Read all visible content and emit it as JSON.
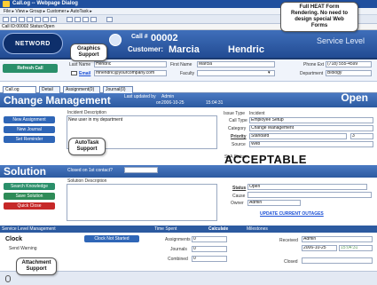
{
  "window": {
    "title": "Call.og -- Webpage Dialog"
  },
  "menu": {
    "text": "File ▸ View ▸ Group ▸ Customer ▸ AutoTask ▸"
  },
  "status_line": {
    "text": "Call ID:00002 Status:Open"
  },
  "header": {
    "logo": "NETWORD",
    "call_label": "Call #",
    "call_number": "00002",
    "customer_label": "Customer:",
    "customer_first": "Marcia",
    "customer_last": "Hendric",
    "service_level_label": "Service Level"
  },
  "refresh_button": "Refresh Call",
  "contact": {
    "last_name_label": "Last Name",
    "last_name": "Hendric",
    "first_name_label": "First Name",
    "first_name": "Marcia",
    "phone_label": "Phone Ext",
    "phone": "(718) 555-4599",
    "email_label": "Email",
    "email": "mhendric@yourcompany.com",
    "faculty_label": "Faculty",
    "faculty": "",
    "department_label": "Department",
    "department": "Biology"
  },
  "tabs": [
    {
      "label": "Call.og"
    },
    {
      "label": "Detail"
    },
    {
      "label": "Assignment(0)"
    },
    {
      "label": "Journal(0)"
    }
  ],
  "change_mgmt": {
    "title": "Change Management",
    "updated_label": "Last updated by",
    "updated_by": "Admin",
    "updated_on_label": "on",
    "updated_date": "2006-10-25",
    "updated_time": "15:04:31",
    "status": "Open",
    "buttons": [
      "New Assignment",
      "New Journal",
      "Set Reminder"
    ],
    "incident_label": "Incident Description",
    "incident_text": "New user in my department",
    "issue_type_label": "Issue Type",
    "issue_type": "Incident",
    "call_type_label": "Call Type",
    "call_type": "Employee Setup",
    "category_label": "Category",
    "category": "Change Management",
    "priority_label": "Priority",
    "priority": "Standard",
    "priority_num": "3",
    "source_label": "Source",
    "source": "Web",
    "sla_label": "SLA Status",
    "sla": "ACCEPTABLE"
  },
  "solution": {
    "title": "Solution",
    "closed_label": "Closed on 1st contact?",
    "buttons": [
      "Search Knowledge",
      "Save Solution",
      "Quick Close"
    ],
    "description_label": "Solution Description",
    "status_label": "Status",
    "status": "Open",
    "cause_label": "Cause",
    "cause": "",
    "owner_label": "Owner",
    "owner": "Admin",
    "update_link": "UPDATE CURRENT OUTAGES"
  },
  "bottom": {
    "sections": [
      "Service Level Management",
      "Time Spent",
      "Calculate",
      "Milestones"
    ],
    "clock_label": "Clock",
    "clock_button": "Clock Not Started",
    "send_warning": "Send Warning",
    "assignments_label": "Assignments",
    "assignments": "0",
    "journals_label": "Journals",
    "journals": "0",
    "combined_label": "Combined",
    "combined": "0",
    "received_label": "Received",
    "received_by": "Admin",
    "received_date": "2006-10-25",
    "received_time": "15:04:31",
    "closed_label": "Closed"
  },
  "callouts": {
    "graphics": "Graphics\nSupport",
    "heat": "Full HEAT Form\nRendering. No need to\ndesign special Web\nForms",
    "autotask": "AutoTask\nSupport",
    "attachment": "Attachment\nSupport"
  },
  "colors": {
    "header": "#2c5aa0",
    "accent_green": "#2e8b57",
    "accent_red": "#c62828"
  }
}
